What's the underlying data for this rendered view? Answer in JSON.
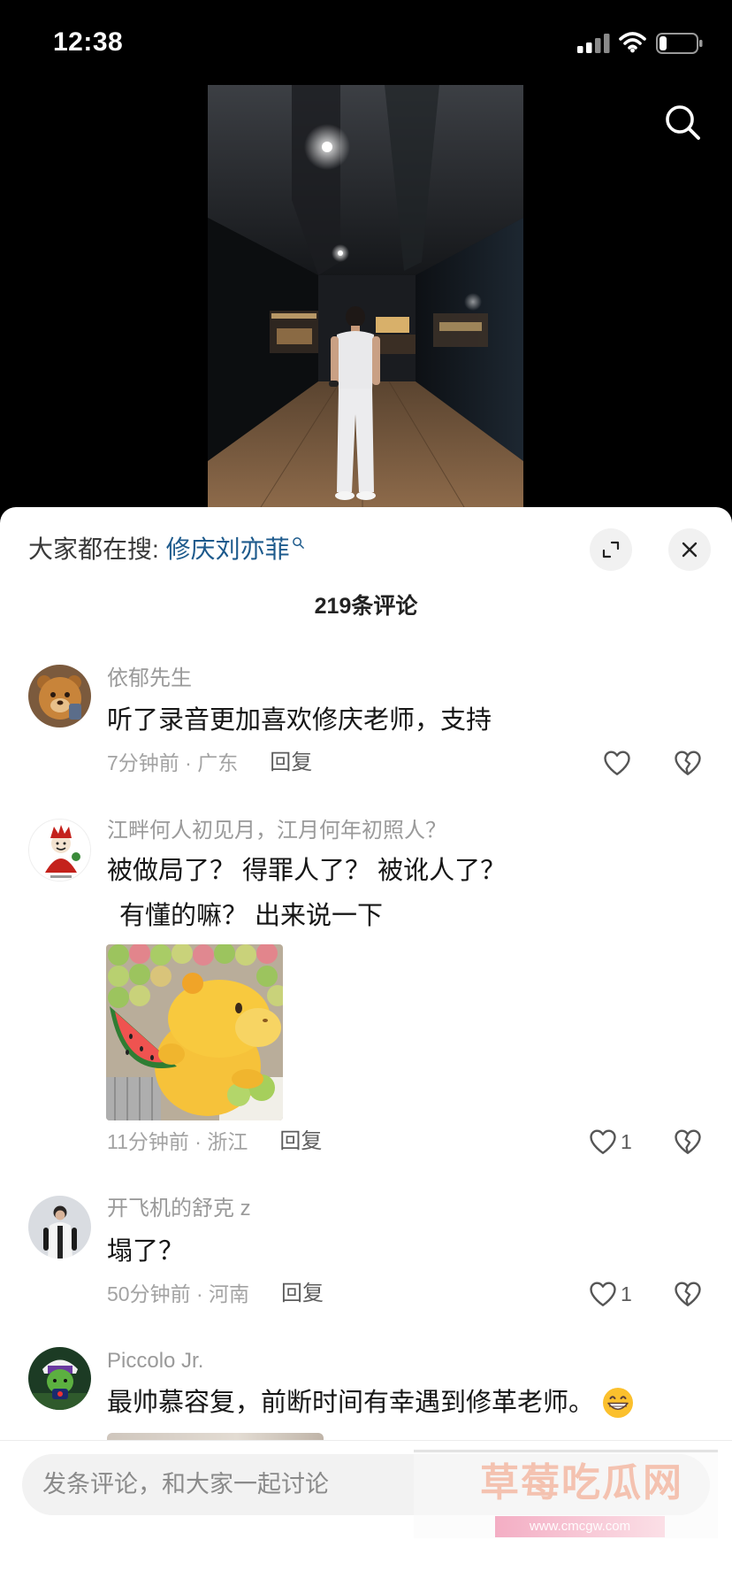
{
  "status_bar": {
    "time": "12:38",
    "battery_level": 0.2
  },
  "sheet": {
    "search_hint": {
      "prefix": "大家都在搜:",
      "keyword": "修庆刘亦菲"
    },
    "comment_count": "219条评论",
    "comments": [
      {
        "name": "依郁先生",
        "lines": [
          "听了录音更加喜欢修庆老师，支持"
        ],
        "meta": "7分钟前 · 广东",
        "reply": "回复"
      },
      {
        "name": "江畔何人初见月，江月何年初照人？",
        "lines": [
          "被做局了？ 得罪人了？ 被讹人了？",
          "有懂的嘛？ 出来说一下"
        ],
        "meta": "11分钟前 · 浙江",
        "reply": "回复",
        "likes": "1"
      },
      {
        "name": "开飞机的舒克 z",
        "lines": [
          "塌了？"
        ],
        "meta": "50分钟前 · 河南",
        "reply": "回复",
        "likes": "1"
      },
      {
        "name": "Piccolo Jr.",
        "lines": [
          "最帅慕容复，前断时间有幸遇到修革老师。"
        ],
        "emoji": "grinning-face"
      }
    ]
  },
  "composer": {
    "placeholder": "发条评论，和大家一起讨论"
  },
  "watermark": {
    "title": "草莓吃瓜网",
    "url": "www.cmcgw.com"
  },
  "colors": {
    "keyword": "#1d5a8c",
    "top_background": "#000000",
    "sheet_background": "#ffffff"
  }
}
